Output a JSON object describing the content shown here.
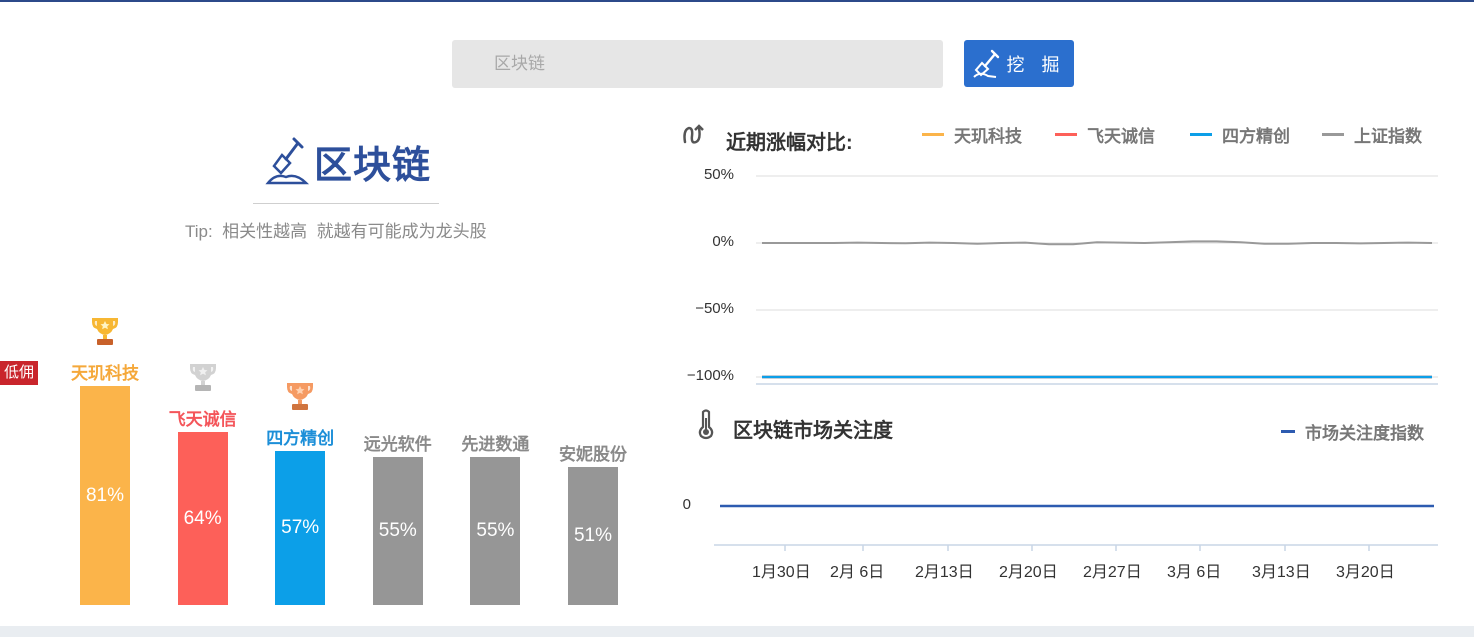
{
  "search": {
    "placeholder": "区块链",
    "button_label": "挖 掘"
  },
  "concept": {
    "title": "区块链",
    "tip": "Tip:  相关性越高  就越有可能成为龙头股"
  },
  "side_tag": "低佣",
  "ranking": [
    {
      "name": "天玑科技",
      "value": 81,
      "label": "81%",
      "color": "#fbb44a",
      "name_color": "#f5a83a",
      "trophy": "gold"
    },
    {
      "name": "飞天诚信",
      "value": 64,
      "label": "64%",
      "color": "#fd6059",
      "name_color": "#f4555a",
      "trophy": "silver"
    },
    {
      "name": "四方精创",
      "value": 57,
      "label": "57%",
      "color": "#0c9fe8",
      "name_color": "#1d8fd8",
      "trophy": "bronze"
    },
    {
      "name": "远光软件",
      "value": 55,
      "label": "55%",
      "color": "#969696",
      "name_color": "#8a8a8a",
      "trophy": ""
    },
    {
      "name": "先进数通",
      "value": 55,
      "label": "55%",
      "color": "#969696",
      "name_color": "#8a8a8a",
      "trophy": ""
    },
    {
      "name": "安妮股份",
      "value": 51,
      "label": "51%",
      "color": "#969696",
      "name_color": "#8a8a8a",
      "trophy": ""
    }
  ],
  "chart_data": [
    {
      "type": "line",
      "title": "近期涨幅对比:",
      "y_ticks": [
        "50%",
        "0%",
        "−50%",
        "−100%"
      ],
      "ylim": [
        -100,
        50
      ],
      "legend_position": "top-right",
      "series": [
        {
          "name": "天玑科技",
          "color": "#fbb44a",
          "values": [
            -100,
            -100
          ]
        },
        {
          "name": "飞天诚信",
          "color": "#fd6059",
          "values": [
            -100,
            -100
          ]
        },
        {
          "name": "四方精创",
          "color": "#0c9fe8",
          "values": [
            -100,
            -100
          ]
        },
        {
          "name": "上证指数",
          "color": "#999999",
          "values": [
            0,
            0,
            0,
            0,
            0.3,
            0,
            -0.2,
            0.3,
            0,
            -0.6,
            0,
            0.3,
            -0.9,
            -0.9,
            0.6,
            0.3,
            0,
            0.6,
            1.2,
            1.2,
            0.6,
            -0.6,
            -0.6,
            0,
            0,
            -0.3,
            0,
            0.3,
            0
          ]
        }
      ]
    },
    {
      "type": "line",
      "title": "区块链市场关注度",
      "y_ticks": [
        "0"
      ],
      "legend_position": "top-right",
      "x_ticks": [
        "1月30日",
        "2月 6日",
        "2月13日",
        "2月20日",
        "2月27日",
        "3月 6日",
        "3月13日",
        "3月20日"
      ],
      "series": [
        {
          "name": "市场关注度指数",
          "color": "#2d5bb0",
          "values": [
            0,
            0
          ]
        }
      ]
    }
  ]
}
